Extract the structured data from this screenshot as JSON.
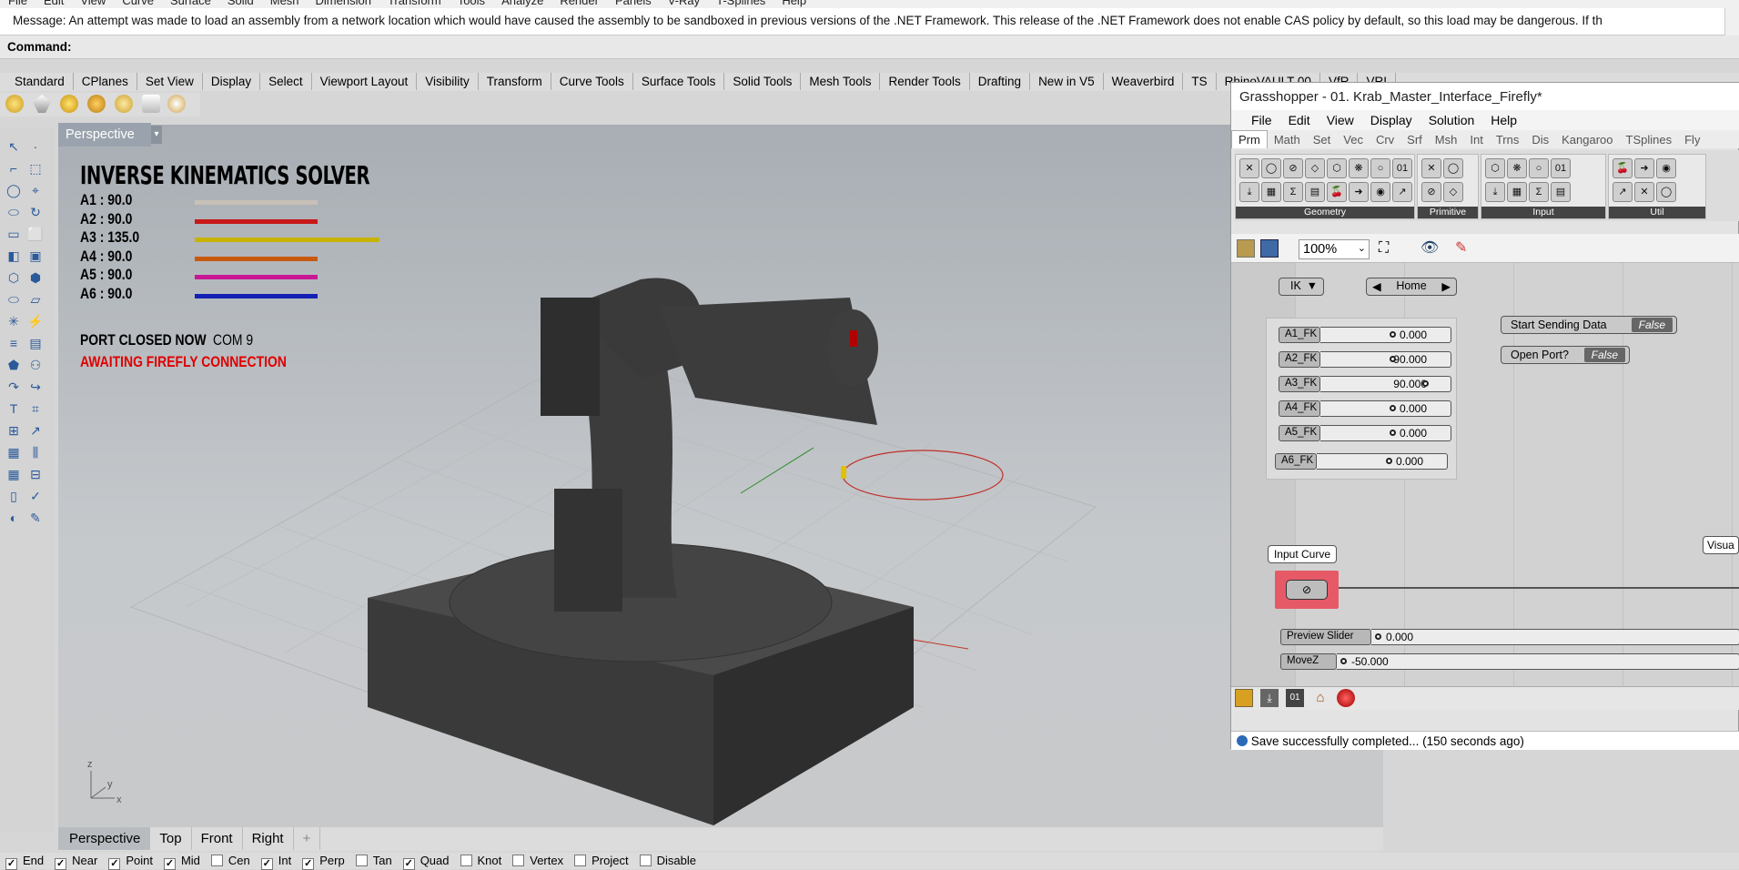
{
  "menubar": [
    "File",
    "Edit",
    "View",
    "Curve",
    "Surface",
    "Solid",
    "Mesh",
    "Dimension",
    "Transform",
    "Tools",
    "Analyze",
    "Render",
    "Panels",
    "V-Ray",
    "T-Splines",
    "Help"
  ],
  "message": "Message: An attempt was made to load an assembly from a network location which would have caused the assembly to be sandboxed in previous versions of the .NET Framework. This release of the .NET Framework does not enable CAS policy by default, so this load may be dangerous. If th",
  "command_label": "Command:",
  "toolbar_tabs": [
    "Standard",
    "CPlanes",
    "Set View",
    "Display",
    "Select",
    "Viewport Layout",
    "Visibility",
    "Transform",
    "Curve Tools",
    "Surface Tools",
    "Solid Tools",
    "Mesh Tools",
    "Render Tools",
    "Drafting",
    "New in V5",
    "Weaverbird",
    "TS",
    "RhinoVAULT 00",
    "VfR",
    "VRI"
  ],
  "viewport": {
    "name": "Perspective",
    "tabs": [
      "Perspective",
      "Top",
      "Front",
      "Right"
    ],
    "add_tab": "+",
    "axis_labels": {
      "z": "z",
      "y": "y",
      "x": "x"
    }
  },
  "ik": {
    "title": "INVERSE KINEMATICS SOLVER",
    "rows": [
      {
        "label": "A1 : 90.0",
        "color": "#c8c0b8",
        "value": 90
      },
      {
        "label": "A2 : 90.0",
        "color": "#c81818",
        "value": 90
      },
      {
        "label": "A3 : 135.0",
        "color": "#c8b400",
        "value": 135
      },
      {
        "label": "A4 : 90.0",
        "color": "#c85a10",
        "value": 90
      },
      {
        "label": "A5 : 90.0",
        "color": "#c81894",
        "value": 90
      },
      {
        "label": "A6 : 90.0",
        "color": "#1420b4",
        "value": 90
      }
    ],
    "port_status": "PORT CLOSED NOW",
    "com": "COM 9",
    "awaiting": "AWAITING FIREFLY CONNECTION"
  },
  "osnap": [
    {
      "label": "End",
      "checked": true
    },
    {
      "label": "Near",
      "checked": true
    },
    {
      "label": "Point",
      "checked": true
    },
    {
      "label": "Mid",
      "checked": true
    },
    {
      "label": "Cen",
      "checked": false
    },
    {
      "label": "Int",
      "checked": true
    },
    {
      "label": "Perp",
      "checked": true
    },
    {
      "label": "Tan",
      "checked": false
    },
    {
      "label": "Quad",
      "checked": true
    },
    {
      "label": "Knot",
      "checked": false
    },
    {
      "label": "Vertex",
      "checked": false
    },
    {
      "label": "Project",
      "checked": false
    },
    {
      "label": "Disable",
      "checked": false
    }
  ],
  "grasshopper": {
    "title": "Grasshopper - 01. Krab_Master_Interface_Firefly*",
    "menu": [
      "File",
      "Edit",
      "View",
      "Display",
      "Solution",
      "Help"
    ],
    "categories": [
      "Prm",
      "Math",
      "Set",
      "Vec",
      "Crv",
      "Srf",
      "Msh",
      "Int",
      "Trns",
      "Dis",
      "Kangaroo",
      "TSplines",
      "Fly"
    ],
    "palette_groups": [
      "Geometry",
      "Primitive",
      "Input",
      "Util"
    ],
    "zoom": "100%",
    "ik_selector": "IK",
    "home_label": "Home",
    "sliders": [
      {
        "label": "A1_FK",
        "value": "0.000",
        "pos": 0.5
      },
      {
        "label": "A2_FK",
        "value": "-90.000",
        "pos": 0.5
      },
      {
        "label": "A3_FK",
        "value": "90.000",
        "pos": 0.75
      },
      {
        "label": "A4_FK",
        "value": "0.000",
        "pos": 0.5
      },
      {
        "label": "A5_FK",
        "value": "0.000",
        "pos": 0.5
      },
      {
        "label": "A6_FK",
        "value": "0.000",
        "pos": 0.5
      }
    ],
    "toggles": [
      {
        "label": "Start Sending Data",
        "value": "False"
      },
      {
        "label": "Open Port?",
        "value": "False"
      }
    ],
    "input_curve_label": "Input Curve",
    "visual_label": "Visua",
    "preview_slider": {
      "label": "Preview Slider",
      "value": "0.000"
    },
    "movez": {
      "label": "MoveZ",
      "value": "-50.000"
    },
    "status": "Save successfully completed... (150 seconds ago)"
  }
}
